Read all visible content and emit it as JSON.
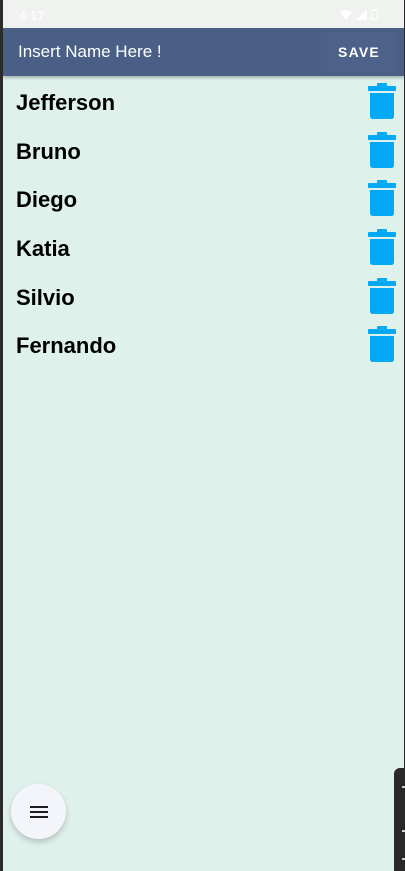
{
  "status_bar": {
    "time": "4:17",
    "icons": [
      "wifi-icon",
      "signal-icon",
      "battery-icon"
    ]
  },
  "app_bar": {
    "input_placeholder": "Insert Name Here !",
    "input_value": "",
    "save_label": "SAVE"
  },
  "names": [
    {
      "label": "Jefferson",
      "icon": "trash-icon"
    },
    {
      "label": "Bruno",
      "icon": "trash-icon"
    },
    {
      "label": "Diego",
      "icon": "trash-icon"
    },
    {
      "label": "Katia",
      "icon": "trash-icon"
    },
    {
      "label": "Silvio",
      "icon": "trash-icon"
    },
    {
      "label": "Fernando",
      "icon": "trash-icon"
    }
  ],
  "fab": {
    "icon": "menu-icon"
  },
  "colors": {
    "app_bar": "#4a5f86",
    "background": "#dff1eb",
    "trash": "#03a9f4",
    "fab": "#f4f5fa"
  }
}
